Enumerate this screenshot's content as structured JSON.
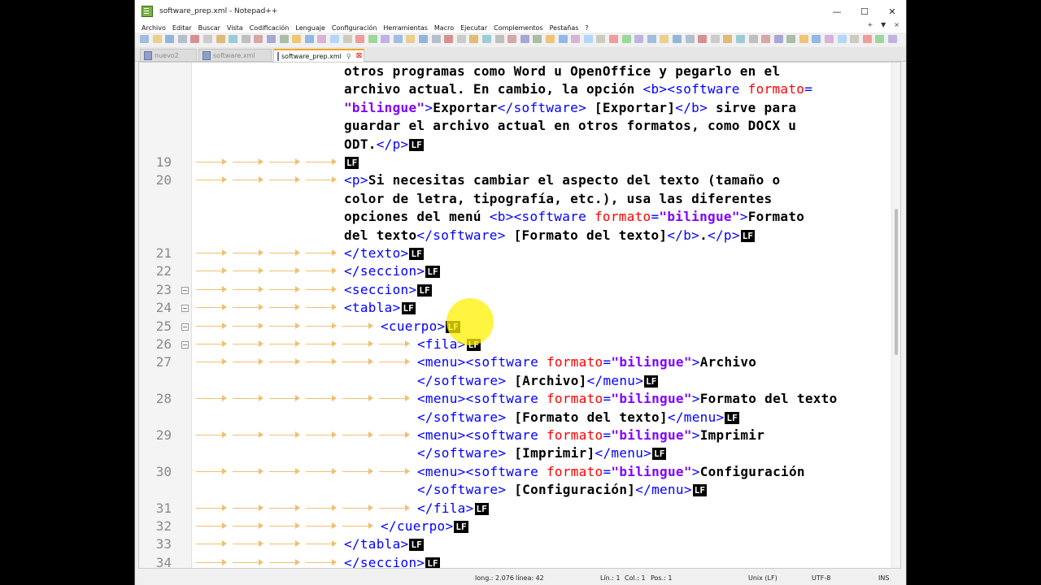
{
  "window": {
    "title": "software_prep.xml - Notepad++",
    "minimize": "—",
    "maximize": "☐",
    "close": "✕"
  },
  "menu": [
    "Archivo",
    "Editar",
    "Buscar",
    "Vista",
    "Codificación",
    "Lenguaje",
    "Configuración",
    "Herramientas",
    "Macro",
    "Ejecutar",
    "Complementos",
    "Pestañas",
    "?"
  ],
  "menu_right": [
    "+",
    "▼",
    "×"
  ],
  "tabs": [
    {
      "label": "nuevo2",
      "active": false
    },
    {
      "label": "software.xml",
      "active": false
    },
    {
      "label": "software_prep.xml",
      "active": true
    }
  ],
  "editor": {
    "lf_label": "LF",
    "lines": [
      {
        "num": "",
        "text": "otros programas como Word u OpenOffice y pegarlo en el"
      },
      {
        "num": "",
        "text": "archivo actual. En cambio, la opción <b><software formato= "
      },
      {
        "num": "",
        "text": "\"bilingue\">Exportar</software> [Exportar]</b> sirve para"
      },
      {
        "num": "",
        "text": "guardar el archivo actual en otros formatos, como DOCX u"
      },
      {
        "num": "",
        "text": "ODT.</p>"
      },
      {
        "num": "19",
        "text": ""
      },
      {
        "num": "20",
        "text": "<p>Si necesitas cambiar el aspecto del texto (tamaño o"
      },
      {
        "num": "",
        "text": "color de letra, tipografía, etc.), usa las diferentes"
      },
      {
        "num": "",
        "text": "opciones del menú <b><software formato=\"bilingue\">Formato"
      },
      {
        "num": "",
        "text": "del texto</software> [Formato del texto]</b>.</p>"
      },
      {
        "num": "21",
        "text": "</texto>"
      },
      {
        "num": "22",
        "text": "</seccion>"
      },
      {
        "num": "23",
        "text": "<seccion>"
      },
      {
        "num": "24",
        "text": "<tabla>"
      },
      {
        "num": "25",
        "text": "<cuerpo>"
      },
      {
        "num": "26",
        "text": "<fila>"
      },
      {
        "num": "27",
        "text": "<menu><software formato=\"bilingue\">Archivo"
      },
      {
        "num": "",
        "text": "</software> [Archivo]</menu>"
      },
      {
        "num": "28",
        "text": "<menu><software formato=\"bilingue\">Formato del texto"
      },
      {
        "num": "",
        "text": "</software> [Formato del texto]</menu>"
      },
      {
        "num": "29",
        "text": "<menu><software formato=\"bilingue\">Imprimir"
      },
      {
        "num": "",
        "text": "</software> [Imprimir]</menu>"
      },
      {
        "num": "30",
        "text": "<menu><software formato=\"bilingue\">Configuración"
      },
      {
        "num": "",
        "text": "</software> [Configuración]</menu>"
      },
      {
        "num": "31",
        "text": "</fila>"
      },
      {
        "num": "32",
        "text": "</cuerpo>"
      },
      {
        "num": "33",
        "text": "</tabla>"
      },
      {
        "num": "34",
        "text": "</seccion>"
      }
    ]
  },
  "status": {
    "length": "long.: 2.076",
    "lines": "línea: 42",
    "ln": "Lín.: 1",
    "col": "Col.: 1",
    "pos": "Pos.: 1",
    "eol": "Unix (LF)",
    "encoding": "UTF-8",
    "mode": "INS"
  },
  "colors": {
    "tag": "#0000ff",
    "attribute": "#ff0000",
    "value": "#8000ff",
    "indent_arrow": "#f0c070",
    "cursor_highlight": "#fff000"
  }
}
